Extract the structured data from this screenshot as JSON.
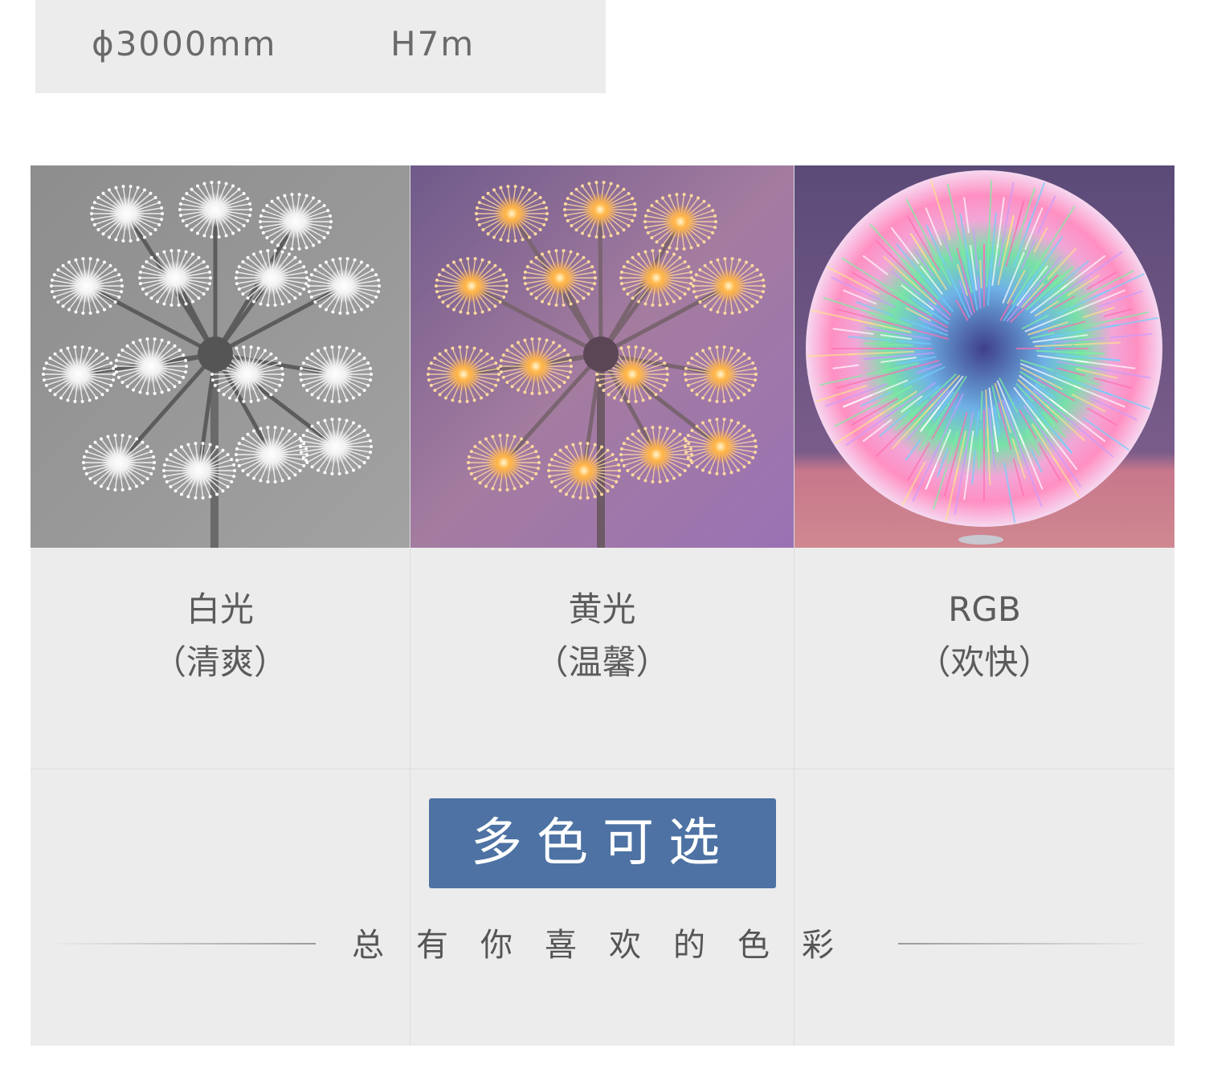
{
  "spec": {
    "diameter": "ϕ3000mm",
    "height": "H7m"
  },
  "options": [
    {
      "title": "白光",
      "subtitle": "（清爽）"
    },
    {
      "title": "黄光",
      "subtitle": "（温馨）"
    },
    {
      "title": "RGB",
      "subtitle": "（欢快）"
    }
  ],
  "badge": "多色可选",
  "slogan": "总有你喜欢的色彩",
  "colors": {
    "badge_bg": "#4d72a3",
    "panel_bg": "#ececec"
  }
}
